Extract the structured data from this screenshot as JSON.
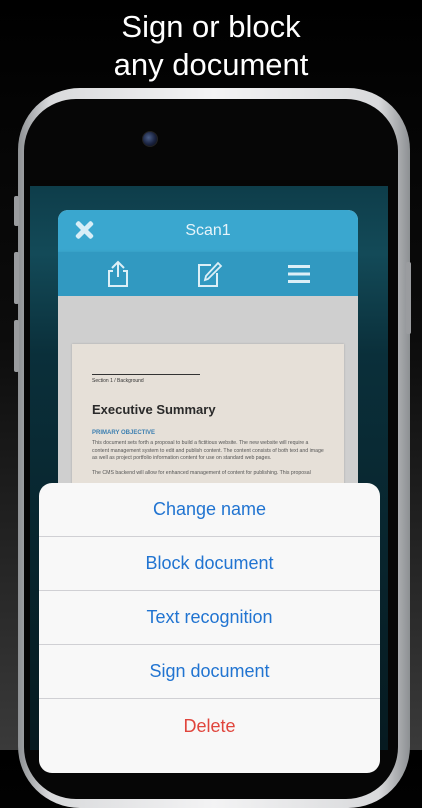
{
  "headline": {
    "line1": "Sign or block",
    "line2": "any document"
  },
  "app": {
    "title": "Scan1",
    "icons": {
      "close": "close-icon",
      "share": "share-icon",
      "edit": "edit-icon",
      "menu": "menu-icon"
    },
    "accent_color": "#3aa7cf"
  },
  "document": {
    "section": "Section 1 / Background",
    "heading": "Executive Summary",
    "subheading": "PRIMARY OBJECTIVE",
    "paragraph1": "This document sets forth a proposal to build a fictitious website. The new website will require a content management system to edit and publish content. The content consists of both text and image as well as project portfolio information content for use on standard web pages.",
    "paragraph2": "The CMS backend will allow for enhanced management of content for publishing. This proposal"
  },
  "action_sheet": {
    "items": [
      {
        "label": "Change name"
      },
      {
        "label": "Block document"
      },
      {
        "label": "Text recognition"
      },
      {
        "label": "Sign document"
      },
      {
        "label": "Delete"
      }
    ],
    "action_color": "#2174d1",
    "destructive_color": "#e0453c"
  }
}
